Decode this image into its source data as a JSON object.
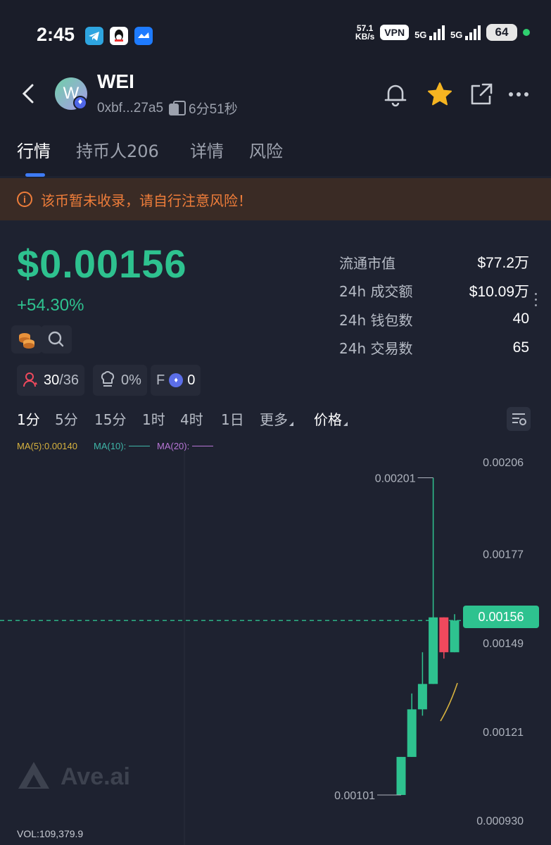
{
  "status_bar": {
    "time": "2:45",
    "net_speed_value": "57.1",
    "net_speed_unit": "KB/s",
    "vpn": "VPN",
    "sim1": "5G",
    "sim2": "5G",
    "battery": "64"
  },
  "header": {
    "avatar_letter": "W",
    "token_name": "WEI",
    "address": "0xbf...27a5",
    "age": "6分51秒"
  },
  "tabs": [
    {
      "label": "行情"
    },
    {
      "label": "持币人206"
    },
    {
      "label": "详情"
    },
    {
      "label": "风险"
    }
  ],
  "warning": {
    "icon": "i",
    "text": "该币暂未收录，请自行注意风险！"
  },
  "price": {
    "value": "$0.00156",
    "change": "+54.30%"
  },
  "stats": [
    {
      "label": "流通市值",
      "value": "$77.2万"
    },
    {
      "label": "24h 成交额",
      "value": "$10.09万"
    },
    {
      "label": "24h 钱包数",
      "value": "40"
    },
    {
      "label": "24h 交易数",
      "value": "65"
    }
  ],
  "chips": {
    "holders_a": "30",
    "holders_b": "/36",
    "chef": "0%",
    "f_label": "F",
    "f_value": "0"
  },
  "intervals": [
    {
      "label": "1分"
    },
    {
      "label": "5分"
    },
    {
      "label": "15分"
    },
    {
      "label": "1时"
    },
    {
      "label": "4时"
    },
    {
      "label": "1日"
    },
    {
      "label": "更多"
    },
    {
      "label": "价格"
    }
  ],
  "ma": {
    "ma5": "MA(5):0.00140",
    "ma10": "MA(10):",
    "ma20": "MA(20):"
  },
  "colors": {
    "up": "#2ec28f",
    "down": "#f0495d",
    "ma5": "#d8b33f",
    "ma10": "#3fb6a8",
    "ma20": "#b876d6"
  },
  "chart_data": {
    "type": "candlestick",
    "y_ticks": [
      "0.00206",
      "0.00177",
      "0.00149",
      "0.00121",
      "0.000930"
    ],
    "y_tick_values": [
      0.00206,
      0.00177,
      0.00149,
      0.00121,
      0.00093
    ],
    "current_price": "0.00156",
    "current_price_value": 0.00156,
    "high_label": "0.00201",
    "high_value": 0.00201,
    "low_label": "0.00101",
    "low_value": 0.00101,
    "candles": [
      {
        "open": 0.00101,
        "close": 0.00113,
        "high": 0.00113,
        "low": 0.00101
      },
      {
        "open": 0.00113,
        "close": 0.00128,
        "high": 0.00133,
        "low": 0.00113
      },
      {
        "open": 0.00128,
        "close": 0.00136,
        "high": 0.00146,
        "low": 0.00126
      },
      {
        "open": 0.00136,
        "close": 0.00157,
        "high": 0.00201,
        "low": 0.00136
      },
      {
        "open": 0.00157,
        "close": 0.00146,
        "high": 0.00157,
        "low": 0.00144
      },
      {
        "open": 0.00146,
        "close": 0.00156,
        "high": 0.00158,
        "low": 0.00146
      }
    ],
    "volume_label": "VOL:109,379.9"
  },
  "watermark": "Ave.ai"
}
